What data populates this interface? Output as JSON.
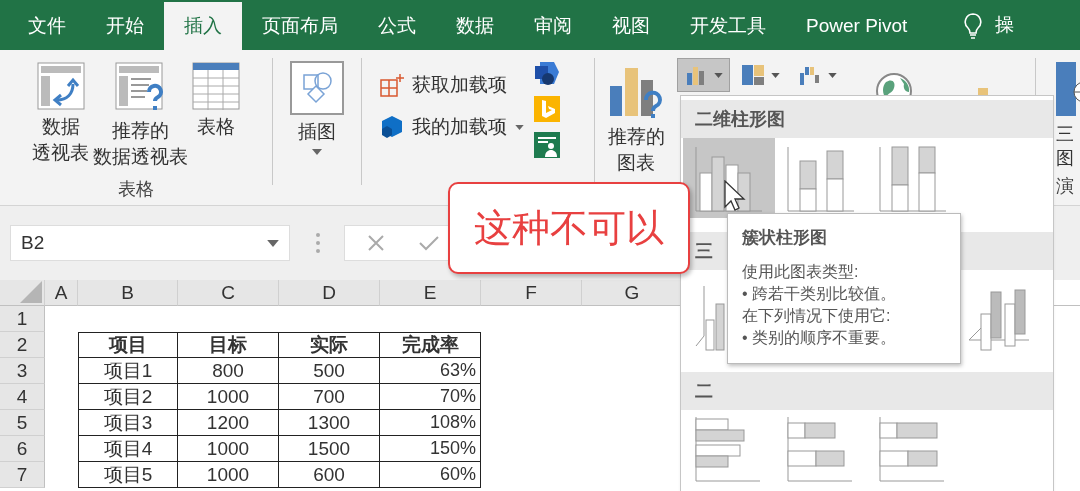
{
  "tabs": [
    {
      "label": "文件",
      "selected": false
    },
    {
      "label": "开始",
      "selected": false
    },
    {
      "label": "插入",
      "selected": true
    },
    {
      "label": "页面布局",
      "selected": false
    },
    {
      "label": "公式",
      "selected": false
    },
    {
      "label": "数据",
      "selected": false
    },
    {
      "label": "审阅",
      "selected": false
    },
    {
      "label": "视图",
      "selected": false
    },
    {
      "label": "开发工具",
      "selected": false
    },
    {
      "label": "Power Pivot",
      "selected": false
    }
  ],
  "tell_me": "操",
  "ribbon": {
    "tables_group": {
      "label": "表格",
      "buttons": [
        {
          "kind": "pivot",
          "lines": [
            "数据",
            "透视表"
          ]
        },
        {
          "kind": "recommended-pivot",
          "lines": [
            "推荐的",
            "数据透视表"
          ]
        },
        {
          "kind": "table",
          "lines": [
            "表格"
          ]
        }
      ]
    },
    "illustrations": {
      "label": "插图"
    },
    "addins": [
      {
        "kind": "get",
        "label": "获取加载项"
      },
      {
        "kind": "mine",
        "label": "我的加载项"
      }
    ],
    "recommended_charts": {
      "lines": [
        "推荐的",
        "图表"
      ]
    },
    "chart_buttons": [
      {
        "kind": "column",
        "selected": true
      },
      {
        "kind": "hierarchy",
        "selected": false
      },
      {
        "kind": "waterfall",
        "selected": false
      }
    ],
    "map_button": {
      "lines": [
        "三",
        "图"
      ]
    },
    "tour_group": {
      "label": "演"
    }
  },
  "formula_bar": {
    "name_box": "B2"
  },
  "sheet": {
    "column_headers": [
      "A",
      "B",
      "C",
      "D",
      "E",
      "F",
      "G"
    ],
    "row_numbers": [
      "1",
      "2",
      "3",
      "4",
      "5",
      "6",
      "7"
    ]
  },
  "table": {
    "header": [
      "项目",
      "目标",
      "实际",
      "完成率"
    ],
    "rows": [
      [
        "项目1",
        "800",
        "500",
        "63%"
      ],
      [
        "项目2",
        "1000",
        "700",
        "70%"
      ],
      [
        "项目3",
        "1200",
        "1300",
        "108%"
      ],
      [
        "项目4",
        "1000",
        "1500",
        "150%"
      ],
      [
        "项目5",
        "1000",
        "600",
        "60%"
      ]
    ]
  },
  "chart_menu": {
    "sections": [
      {
        "title": "二维柱形图",
        "thumbs": [
          {
            "kind": "clustered-column",
            "selected": true
          },
          {
            "kind": "stacked-column",
            "selected": false
          },
          {
            "kind": "percent-column",
            "selected": false
          }
        ]
      },
      {
        "title": "三",
        "thumbs": [
          {
            "kind": "clustered3d",
            "selected": false
          },
          {
            "kind": "column3d",
            "selected": false
          }
        ]
      },
      {
        "title": "二",
        "thumbs": [
          {
            "kind": "clustered-bar",
            "selected": false
          },
          {
            "kind": "stacked-bar",
            "selected": false
          },
          {
            "kind": "percent-bar",
            "selected": false
          }
        ]
      }
    ]
  },
  "tooltip": {
    "title": "簇状柱形图",
    "lines": [
      "使用此图表类型:",
      "• 跨若干类别比较值。",
      "在下列情况下使用它:",
      "• 类别的顺序不重要。"
    ]
  },
  "callout": "这种不可以"
}
